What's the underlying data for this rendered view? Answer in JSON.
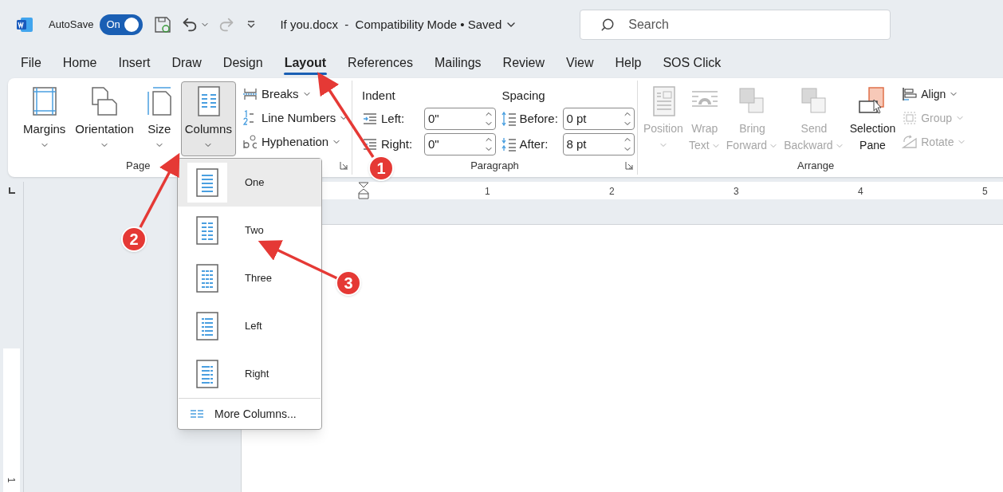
{
  "title_bar": {
    "autosave_label": "AutoSave",
    "autosave": {
      "label": "On",
      "on": true
    },
    "document_title": "If you.docx  -  Compatibility Mode • Saved",
    "search": {
      "placeholder": "Search"
    }
  },
  "tabs": [
    {
      "label": "File",
      "selected": false
    },
    {
      "label": "Home",
      "selected": false
    },
    {
      "label": "Insert",
      "selected": false
    },
    {
      "label": "Draw",
      "selected": false
    },
    {
      "label": "Design",
      "selected": false
    },
    {
      "label": "Layout",
      "selected": true
    },
    {
      "label": "References",
      "selected": false
    },
    {
      "label": "Mailings",
      "selected": false
    },
    {
      "label": "Review",
      "selected": false
    },
    {
      "label": "View",
      "selected": false
    },
    {
      "label": "Help",
      "selected": false
    },
    {
      "label": "SOS Click",
      "selected": false
    }
  ],
  "page_setup": {
    "label": "Page",
    "large_buttons": [
      {
        "lines": [
          "Margins"
        ],
        "menu": true,
        "selected": false
      },
      {
        "lines": [
          "Orientation"
        ],
        "menu": true,
        "selected": false
      },
      {
        "lines": [
          "Size"
        ],
        "menu": true,
        "selected": false
      },
      {
        "lines": [
          "Columns"
        ],
        "menu": true,
        "selected": true
      }
    ],
    "small_buttons": [
      {
        "label": "Breaks"
      },
      {
        "label": "Line Numbers"
      },
      {
        "label": "Hyphenation"
      }
    ]
  },
  "paragraph": {
    "label": "Paragraph",
    "indent_heading": "Indent",
    "spacing_heading": "Spacing",
    "fields": [
      {
        "label": "Left:",
        "value": "0\""
      },
      {
        "label": "Before:",
        "value": "0 pt"
      },
      {
        "label": "Right:",
        "value": "0\""
      },
      {
        "label": "After:",
        "value": "8 pt"
      }
    ]
  },
  "arrange": {
    "label": "Arrange",
    "large_buttons": [
      {
        "lines": [
          "Position"
        ],
        "menu": true,
        "disabled": true
      },
      {
        "lines": [
          "Wrap",
          "Text"
        ],
        "menu": true,
        "disabled": true
      },
      {
        "lines": [
          "Bring",
          "Forward"
        ],
        "menu": true,
        "disabled": true
      },
      {
        "lines": [
          "Send",
          "Backward"
        ],
        "menu": true,
        "disabled": true
      },
      {
        "lines": [
          "Selection",
          "Pane"
        ],
        "menu": false,
        "disabled": false
      }
    ],
    "small_buttons": [
      {
        "label": "Align",
        "disabled": false
      },
      {
        "label": "Group",
        "disabled": true
      },
      {
        "label": "Rotate",
        "disabled": true
      }
    ]
  },
  "ruler": {
    "numbers": [
      "1",
      "2",
      "3",
      "4",
      "5"
    ]
  },
  "vertical_ruler": {
    "number": "1"
  },
  "columns_menu": {
    "items": [
      {
        "label": "One",
        "selected": true
      },
      {
        "label": "Two",
        "selected": false
      },
      {
        "label": "Three",
        "selected": false
      },
      {
        "label": "Left",
        "selected": false
      },
      {
        "label": "Right",
        "selected": false
      }
    ],
    "more": "More Columns..."
  },
  "callouts": [
    {
      "number": "1"
    },
    {
      "number": "2"
    },
    {
      "number": "3"
    }
  ]
}
